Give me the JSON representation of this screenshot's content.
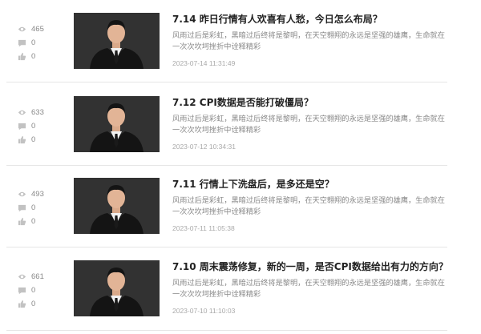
{
  "articles": [
    {
      "title": "7.14 昨日行情有人欢喜有人愁，今日怎么布局？",
      "summary": "风雨过后是彩虹，黑暗过后终将是黎明，在天空翱翔的永远是坚强的雄鹰，生命就在一次次坎坷挫折中诠释精彩",
      "date": "2023-07-14 11:31:49",
      "views": "465",
      "comments": "0",
      "likes": "0"
    },
    {
      "title": "7.12 CPI数据是否能打破僵局？",
      "summary": "风雨过后是彩虹，黑暗过后终将是黎明，在天空翱翔的永远是坚强的雄鹰，生命就在一次次坎坷挫折中诠释精彩",
      "date": "2023-07-12 10:34:31",
      "views": "633",
      "comments": "0",
      "likes": "0"
    },
    {
      "title": "7.11 行情上下洗盘后，是多还是空？",
      "summary": "风雨过后是彩虹，黑暗过后终将是黎明，在天空翱翔的永远是坚强的雄鹰，生命就在一次次坎坷挫折中诠释精彩",
      "date": "2023-07-11 11:05:38",
      "views": "493",
      "comments": "0",
      "likes": "0"
    },
    {
      "title": "7.10 周末震荡修复，新的一周，是否CPI数据给出有力的方向？",
      "summary": "风雨过后是彩虹，黑暗过后终将是黎明，在天空翱翔的永远是坚强的雄鹰，生命就在一次次坎坷挫折中诠释精彩",
      "date": "2023-07-10 11:10:03",
      "views": "661",
      "comments": "0",
      "likes": "0"
    }
  ],
  "icons": {
    "views": "eye-icon",
    "comments": "comment-icon",
    "likes": "thumbs-up-icon"
  },
  "colors": {
    "title": "#222222",
    "summary": "#888888",
    "date": "#aaaaaa",
    "icon": "#b5b5b5",
    "thumb_bg": "#2e2e2e"
  }
}
